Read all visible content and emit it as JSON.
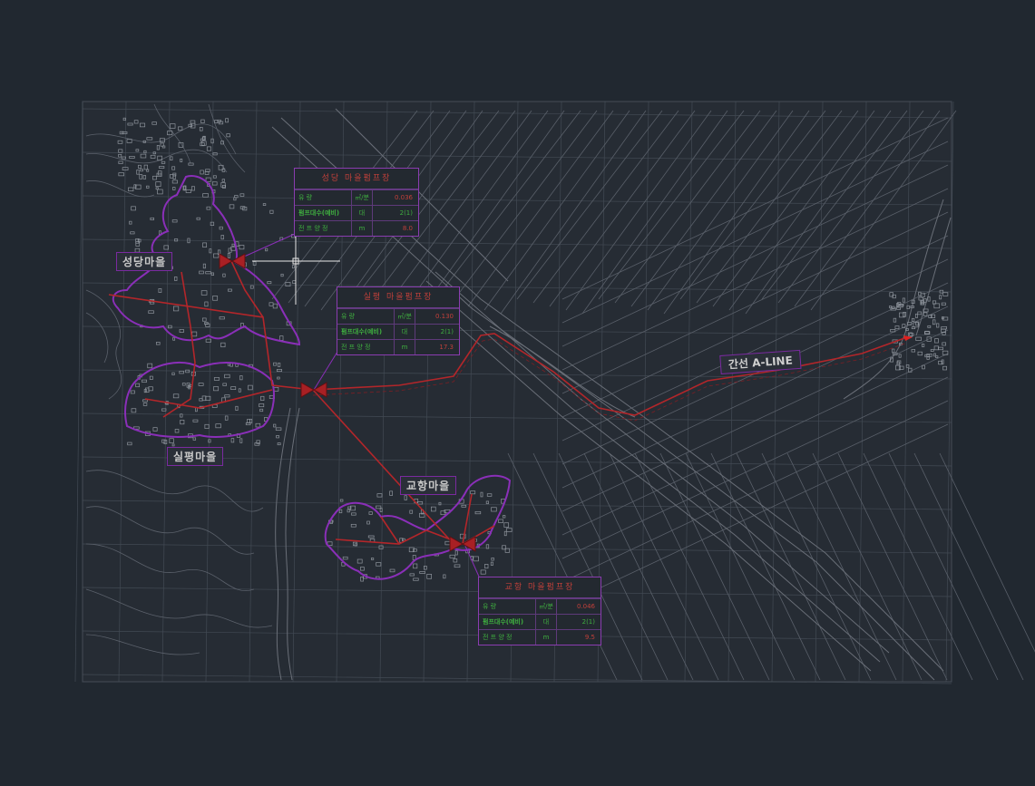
{
  "villages": {
    "seongdang": "성당마을",
    "silpyeong": "실평마을",
    "gyohang": "교항마을"
  },
  "trunk_line": "간선 A-LINE",
  "tables": {
    "seongdang": {
      "title": "성당 마을펌프장",
      "rows": [
        {
          "label": "유 량",
          "unit": "㎥/분",
          "value": "0.036"
        },
        {
          "label": "펌프대수(예비)",
          "unit": "대",
          "value": "2(1)"
        },
        {
          "label": "전 프 양 정",
          "unit": "m",
          "value": "8.0"
        }
      ]
    },
    "silpyeong": {
      "title": "실평 마을펌프장",
      "rows": [
        {
          "label": "유 량",
          "unit": "㎥/분",
          "value": "0.130"
        },
        {
          "label": "펌프대수(예비)",
          "unit": "대",
          "value": "2(1)"
        },
        {
          "label": "전 프 양 정",
          "unit": "m",
          "value": "17.3"
        }
      ]
    },
    "gyohang": {
      "title": "교항 마을펌프장",
      "rows": [
        {
          "label": "유 량",
          "unit": "㎥/분",
          "value": "0.046"
        },
        {
          "label": "펌프대수(예비)",
          "unit": "대",
          "value": "2(1)"
        },
        {
          "label": "전 프 양 정",
          "unit": "m",
          "value": "9.5"
        }
      ]
    }
  },
  "colors": {
    "background": "#212830",
    "grid": "#4a525c",
    "pipe": "#b3262a",
    "boundary": "#8a2fb8",
    "road": "#6a6f78"
  }
}
